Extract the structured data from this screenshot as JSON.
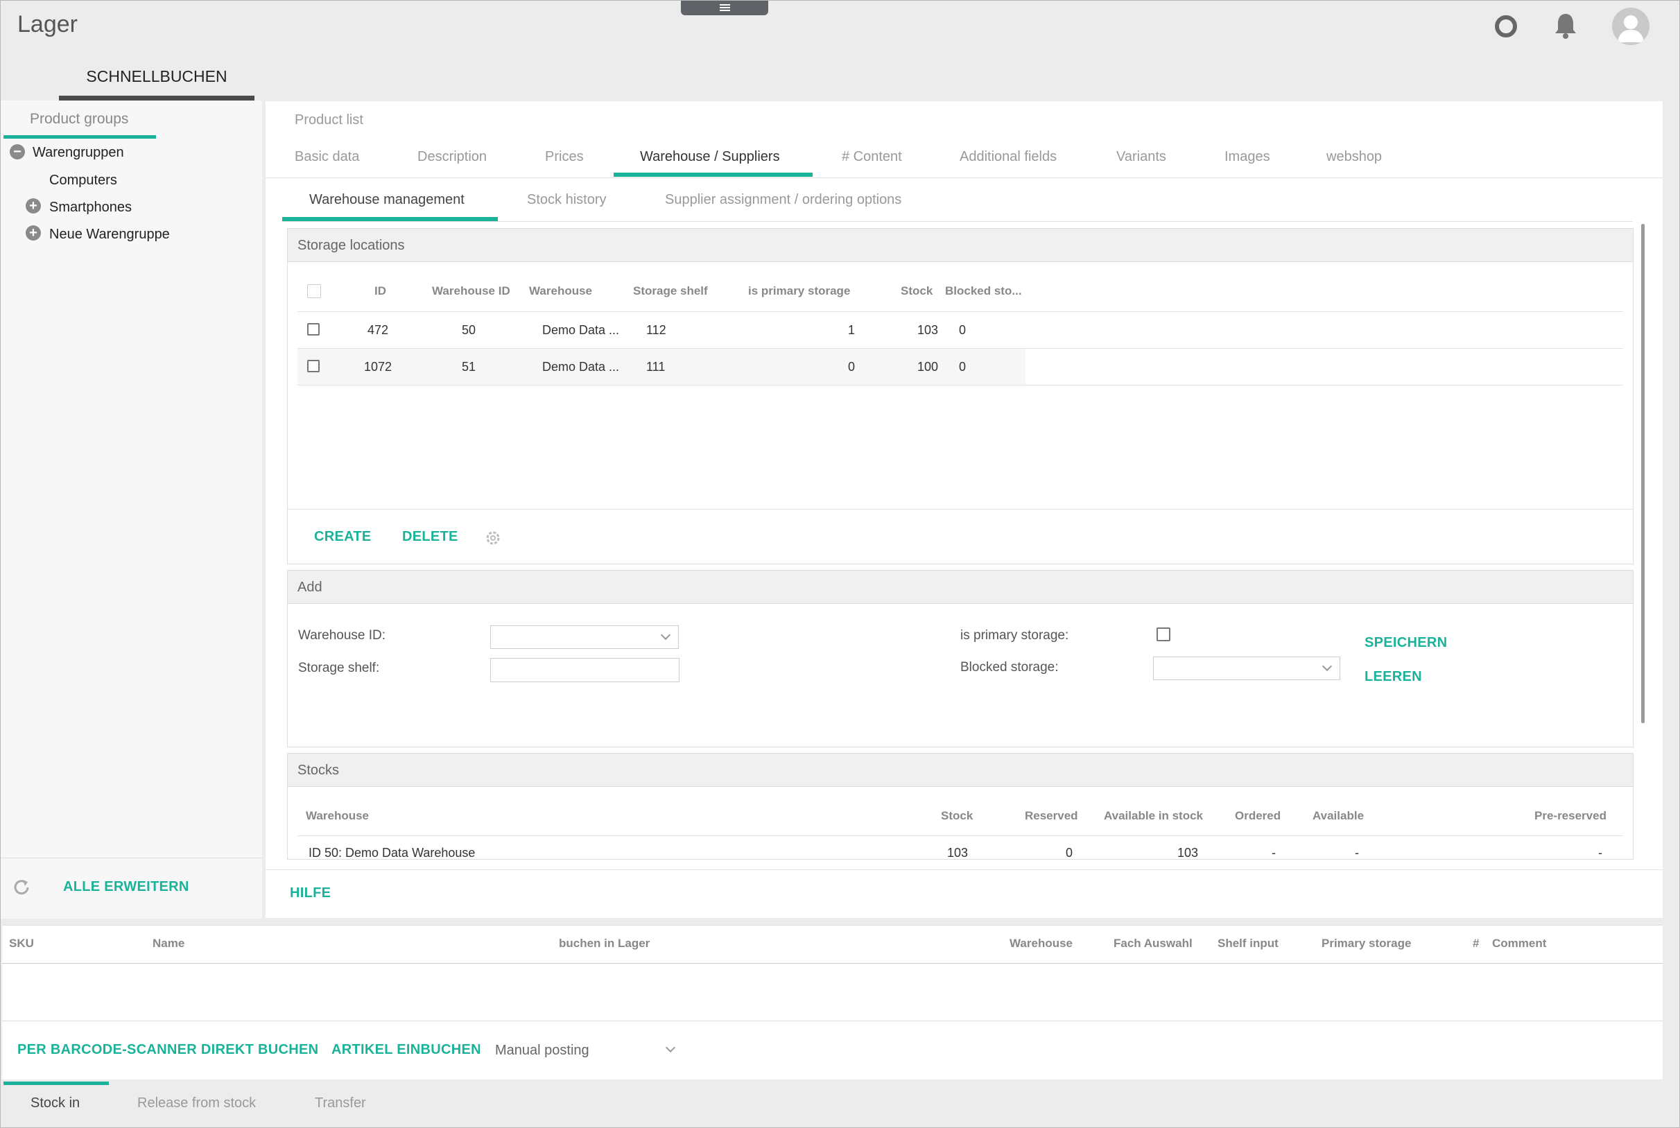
{
  "app": {
    "title": "Lager"
  },
  "top_tab": {
    "label": "SCHNELLBUCHEN"
  },
  "sidebar": {
    "title": "Product groups",
    "tree": [
      {
        "label": "Warengruppen",
        "state": "collapse"
      },
      {
        "label": "Computers",
        "state": "leaf"
      },
      {
        "label": "Smartphones",
        "state": "expand"
      },
      {
        "label": "Neue Warengruppe",
        "state": "expand"
      }
    ],
    "expand_all_label": "ALLE ERWEITERN"
  },
  "product": {
    "header": "Product list",
    "tabs": [
      "Basic data",
      "Description",
      "Prices",
      "Warehouse / Suppliers",
      "# Content",
      "Additional fields",
      "Variants",
      "Images",
      "webshop"
    ],
    "active_tab": "Warehouse / Suppliers",
    "subtabs": [
      "Warehouse management",
      "Stock history",
      "Supplier assignment / ordering options"
    ],
    "active_subtab": "Warehouse management"
  },
  "storage": {
    "title": "Storage locations",
    "columns": [
      "ID",
      "Warehouse ID",
      "Warehouse",
      "Storage shelf",
      "is primary storage",
      "Stock",
      "Blocked sto..."
    ],
    "rows": [
      {
        "id": "472",
        "warehouse_id": "50",
        "warehouse": "Demo Data ...",
        "shelf": "112",
        "primary": "1",
        "stock": "103",
        "blocked": "0"
      },
      {
        "id": "1072",
        "warehouse_id": "51",
        "warehouse": "Demo Data ...",
        "shelf": "111",
        "primary": "0",
        "stock": "100",
        "blocked": "0"
      }
    ],
    "create_label": "CREATE",
    "delete_label": "DELETE"
  },
  "add": {
    "title": "Add",
    "warehouse_id_label": "Warehouse ID:",
    "storage_shelf_label": "Storage shelf:",
    "primary_label": "is primary storage:",
    "blocked_label": "Blocked storage:",
    "save_label": "SPEICHERN",
    "clear_label": "LEEREN"
  },
  "stocks": {
    "title": "Stocks",
    "columns": [
      "Warehouse",
      "Stock",
      "Reserved",
      "Available in stock",
      "Ordered",
      "Available",
      "Pre-reserved"
    ],
    "rows": [
      {
        "warehouse": "ID 50: Demo Data Warehouse",
        "stock": "103",
        "reserved": "0",
        "available_in_stock": "103",
        "ordered": "-",
        "available": "-",
        "pre_reserved": "-"
      }
    ]
  },
  "help_label": "HILFE",
  "booking": {
    "columns": [
      "SKU",
      "Name",
      "buchen in Lager",
      "Warehouse",
      "Fach Auswahl",
      "Shelf input",
      "Primary storage",
      "#",
      "Comment"
    ],
    "barcode_label": "PER BARCODE-SCANNER DIREKT BUCHEN",
    "artikel_label": "ARTIKEL EINBUCHEN",
    "mode_value": "Manual posting"
  },
  "bottom_tabs": [
    "Stock in",
    "Release from stock",
    "Transfer"
  ],
  "active_bottom_tab": "Stock in",
  "icons": {
    "menu": "hamburger-icon",
    "status": "ring-icon",
    "notifications": "bell-icon",
    "user": "avatar-icon",
    "refresh": "refresh-icon",
    "settings": "gear-icon"
  },
  "colors": {
    "accent": "#1ab39a",
    "dark_underline": "#4a4a4a"
  }
}
